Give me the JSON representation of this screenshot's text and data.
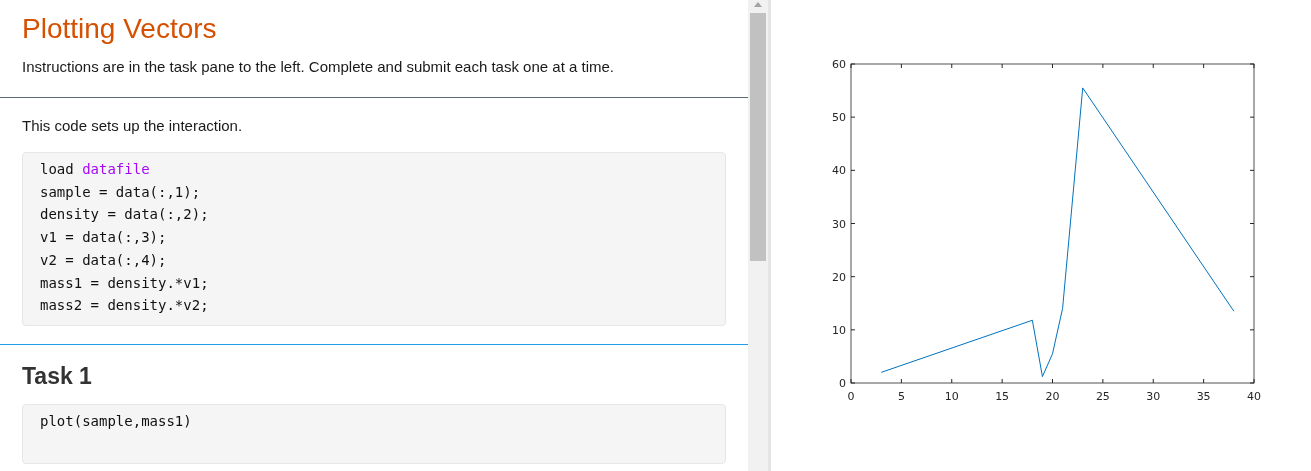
{
  "header": {
    "title": "Plotting Vectors",
    "subtitle": "Instructions are in the task pane to the left. Complete and submit each task one at a time."
  },
  "setup": {
    "text": "This code sets up the interaction.",
    "code": [
      [
        {
          "kind": "plain",
          "text": "load "
        },
        {
          "kind": "keyword",
          "text": "datafile"
        }
      ],
      [
        {
          "kind": "plain",
          "text": "sample = data(:,1);"
        }
      ],
      [
        {
          "kind": "plain",
          "text": "density = data(:,2);"
        }
      ],
      [
        {
          "kind": "plain",
          "text": "v1 = data(:,3);"
        }
      ],
      [
        {
          "kind": "plain",
          "text": "v2 = data(:,4);"
        }
      ],
      [
        {
          "kind": "plain",
          "text": "mass1 = density.*v1;"
        }
      ],
      [
        {
          "kind": "plain",
          "text": "mass2 = density.*v2;"
        }
      ]
    ]
  },
  "task": {
    "title": "Task 1",
    "code": "plot(sample,mass1)"
  },
  "plot": {
    "chart_data": {
      "type": "line",
      "x": [
        3,
        18,
        19,
        20,
        21,
        23,
        38
      ],
      "series": [
        {
          "color": "#0072bd",
          "values": [
            2,
            11.8,
            1.2,
            5.5,
            14,
            55.5,
            13.5
          ]
        }
      ],
      "xlim": [
        0,
        40
      ],
      "ylim": [
        0,
        60
      ],
      "xticks": [
        0,
        5,
        10,
        15,
        20,
        25,
        30,
        35,
        40
      ],
      "yticks": [
        0,
        10,
        20,
        30,
        40,
        50,
        60
      ]
    }
  }
}
